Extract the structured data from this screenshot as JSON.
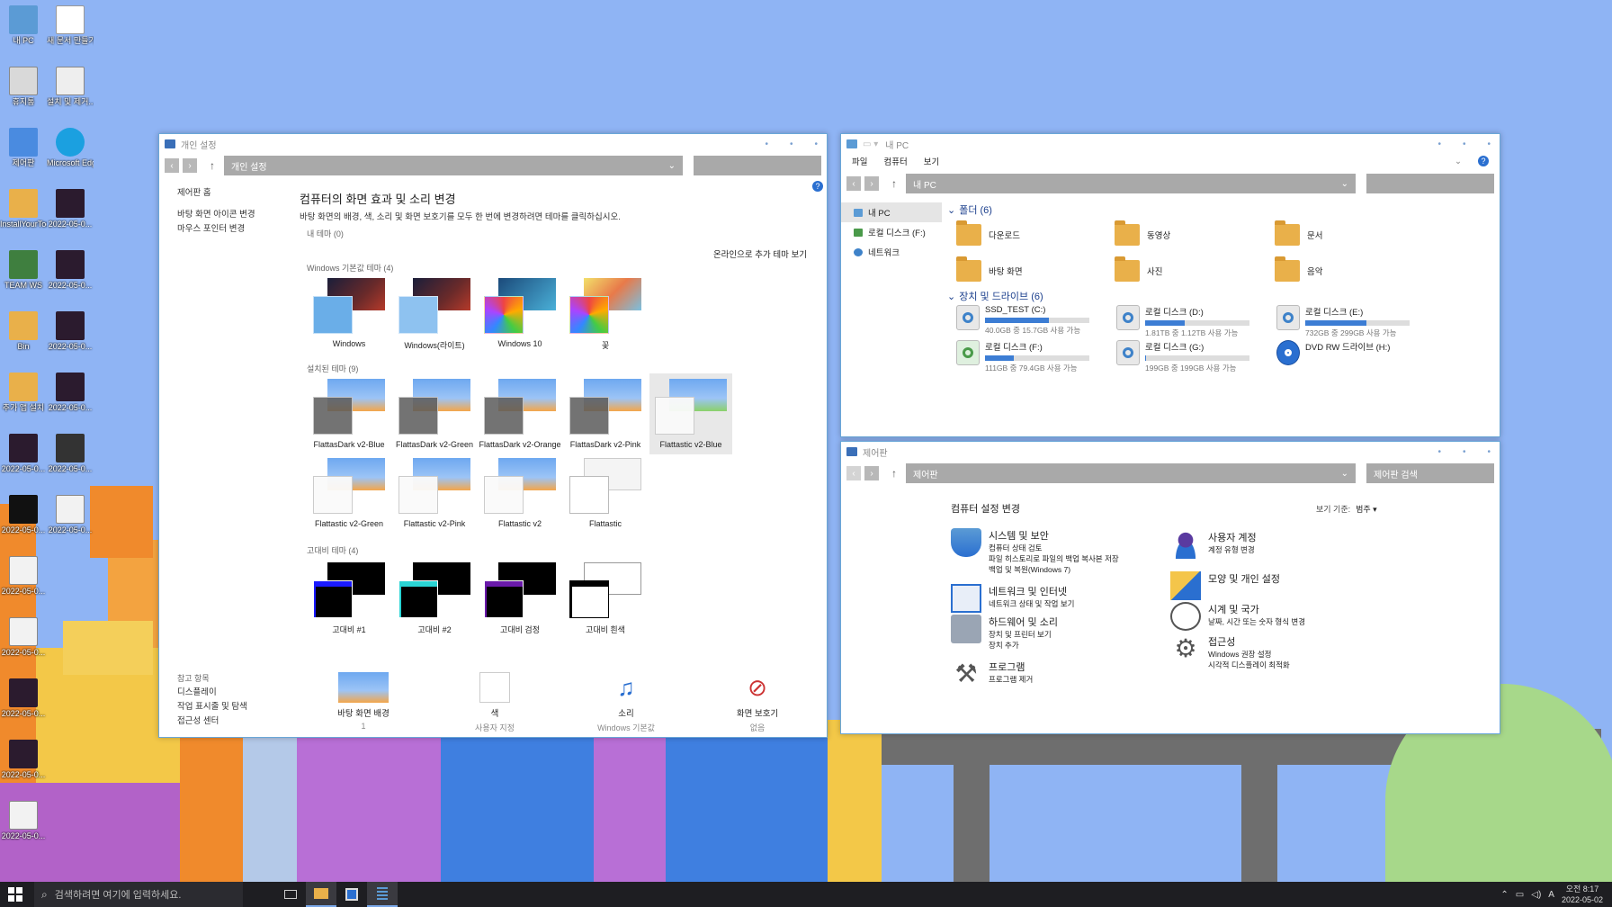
{
  "desktop": {
    "icons": [
      {
        "label": "내 PC"
      },
      {
        "label": "새 문서 만들기..."
      },
      {
        "label": "휴지통"
      },
      {
        "label": "설치 및 제거..."
      },
      {
        "label": "제어판"
      },
      {
        "label": "Microsoft Edge"
      },
      {
        "label": "InstallYourTool"
      },
      {
        "label": "2022-05-0..."
      },
      {
        "label": "TEAM WS"
      },
      {
        "label": "2022-05-0..."
      },
      {
        "label": "Bin"
      },
      {
        "label": "2022-05-0..."
      },
      {
        "label": "추가 앱 설치"
      },
      {
        "label": "2022-05-0..."
      },
      {
        "label": "2022-05-0..."
      },
      {
        "label": "2022-05-0..."
      },
      {
        "label": "2022-05-0..."
      },
      {
        "label": "2022-05-0..."
      },
      {
        "label": "2022-05-0..."
      },
      {
        "label": "2022-05-0..."
      },
      {
        "label": "2022-05-0..."
      },
      {
        "label": "2022-05-0..."
      },
      {
        "label": "2022-05-0..."
      }
    ]
  },
  "personalization": {
    "window_title": "개인 설정",
    "address": "개인 설정",
    "help_icon": "question-icon",
    "sidebar": {
      "home": "제어판 홈",
      "links": [
        "바탕 화면 아이콘 변경",
        "마우스 포인터 변경"
      ],
      "see_also_title": "참고 항목",
      "see_also": [
        "디스플레이",
        "작업 표시줄 및 탐색",
        "접근성 센터"
      ]
    },
    "heading": "컴퓨터의 화면 효과 및 소리 변경",
    "subheading": "바탕 화면의 배경, 색, 소리 및 화면 보호기를 모두 한 번에 변경하려면 테마를 클릭하십시오.",
    "my_themes": "내 테마 (0)",
    "online_link": "온라인으로 추가 테마 보기",
    "default_section": "Windows 기본값 테마 (4)",
    "default_themes": [
      "Windows",
      "Windows(라이트)",
      "Windows 10",
      "꽃"
    ],
    "installed_section": "설치된 테마 (9)",
    "installed_themes": [
      "FlattasDark v2-Blue",
      "FlattasDark v2-Green",
      "FlattasDark v2-Orange",
      "FlattasDark v2-Pink",
      "Flattastic v2-Blue",
      "Flattastic v2-Green",
      "Flattastic v2-Pink",
      "Flattastic v2",
      "Flattastic"
    ],
    "hc_section": "고대비 테마 (4)",
    "hc_themes": [
      "고대비 #1",
      "고대비 #2",
      "고대비 검정",
      "고대비 흰색"
    ],
    "bottom": [
      {
        "title": "바탕 화면 배경",
        "value": "1"
      },
      {
        "title": "색",
        "value": "사용자 지정"
      },
      {
        "title": "소리",
        "value": "Windows 기본값"
      },
      {
        "title": "화면 보호기",
        "value": "없음"
      }
    ]
  },
  "explorer": {
    "window_title": "내 PC",
    "menu": [
      "파일",
      "컴퓨터",
      "보기"
    ],
    "address": "내 PC",
    "tree": [
      "내 PC",
      "로컬 디스크 (F:)",
      "네트워크"
    ],
    "folders_group": "폴더 (6)",
    "folders": [
      "다운로드",
      "동영상",
      "문서",
      "바탕 화면",
      "사진",
      "음악"
    ],
    "drives_group": "장치 및 드라이브 (6)",
    "drives": [
      {
        "name": "SSD_TEST (C:)",
        "info": "40.0GB 중 15.7GB 사용 가능",
        "used_fraction": 0.61
      },
      {
        "name": "로컬 디스크 (D:)",
        "info": "1.81TB 중 1.12TB 사용 가능",
        "used_fraction": 0.38
      },
      {
        "name": "로컬 디스크 (E:)",
        "info": "732GB 중 299GB 사용 가능",
        "used_fraction": 0.59
      },
      {
        "name": "로컬 디스크 (F:)",
        "info": "111GB 중 79.4GB 사용 가능",
        "used_fraction": 0.28
      },
      {
        "name": "로컬 디스크 (G:)",
        "info": "199GB 중 199GB 사용 가능",
        "used_fraction": 0.01
      },
      {
        "name": "DVD RW 드라이브 (H:)",
        "info": "",
        "used_fraction": null
      }
    ]
  },
  "control_panel": {
    "window_title": "제어판",
    "address": "제어판",
    "search": "제어판 검색",
    "heading": "컴퓨터 설정 변경",
    "view_by_label": "보기 기준:",
    "view_by_value": "범주 ▾",
    "categories": [
      {
        "title": "시스템 및 보안",
        "links": [
          "컴퓨터 상태 검토",
          "파일 히스토리로 파일의 백업 복사본 저장",
          "백업 및 복원(Windows 7)"
        ]
      },
      {
        "title": "네트워크 및 인터넷",
        "links": [
          "네트워크 상태 및 작업 보기"
        ]
      },
      {
        "title": "하드웨어 및 소리",
        "links": [
          "장치 및 프린터 보기",
          "장치 추가"
        ]
      },
      {
        "title": "프로그램",
        "links": [
          "프로그램 제거"
        ]
      },
      {
        "title": "사용자 계정",
        "links": [
          "계정 유형 변경"
        ]
      },
      {
        "title": "모양 및 개인 설정",
        "links": []
      },
      {
        "title": "시계 및 국가",
        "links": [
          "날짜, 시간 또는 숫자 형식 변경"
        ]
      },
      {
        "title": "접근성",
        "links": [
          "Windows 권장 설정",
          "시각적 디스플레이 최적화"
        ]
      }
    ]
  },
  "taskbar": {
    "search_placeholder": "검색하려면 여기에 입력하세요.",
    "time": "오전 8:17",
    "date": "2022-05-02",
    "ime": "A"
  }
}
